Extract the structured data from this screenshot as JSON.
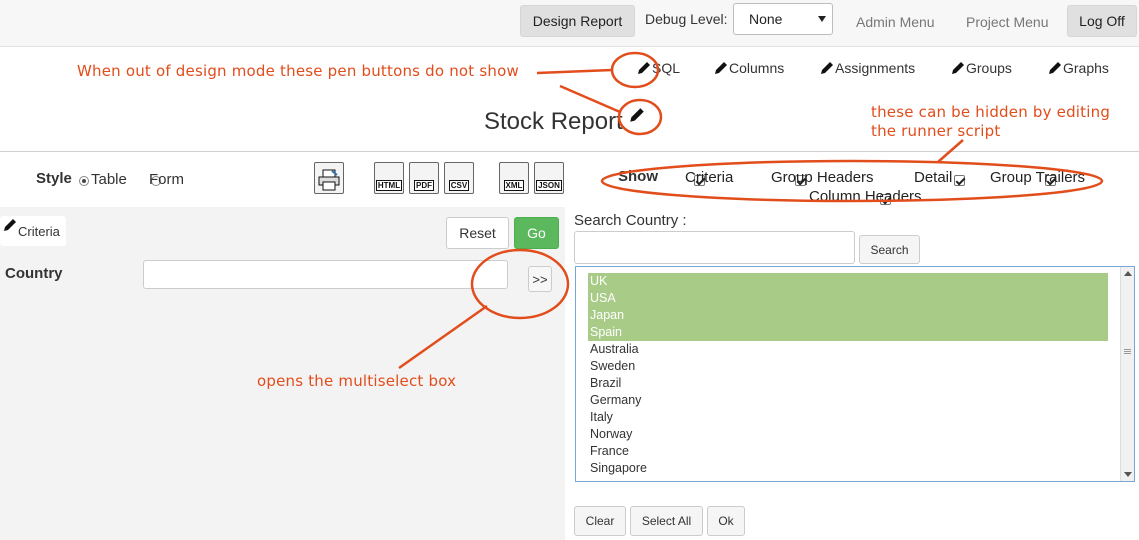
{
  "topbar": {
    "design_report": "Design Report",
    "debug_label": "Debug Level:",
    "debug_value": "None",
    "admin_menu": "Admin Menu",
    "project_menu": "Project Menu",
    "log_off": "Log Off"
  },
  "design_tabs": [
    "SQL",
    "Columns",
    "Assignments",
    "Groups",
    "Graphs"
  ],
  "annotations": {
    "pen_note": "When out of design mode these pen buttons do not show",
    "hidden_note_line1": "these can be hidden by editing",
    "hidden_note_line2": "the runner script",
    "multiselect_note": "opens the multiselect box"
  },
  "report_title": "Stock Report",
  "style": {
    "label": "Style",
    "options": [
      "Table",
      "Form"
    ],
    "selected": "Table"
  },
  "outputs": [
    "HTML",
    "PDF",
    "CSV",
    "XML",
    "JSON"
  ],
  "show": {
    "label": "Show",
    "options": [
      "Criteria",
      "Group Headers",
      "Detail",
      "Group Trailers",
      "Column Headers"
    ]
  },
  "criteria": {
    "link": "Criteria",
    "reset": "Reset",
    "go": "Go",
    "field_label": "Country",
    "expand_button": ">>",
    "field_value": ""
  },
  "search": {
    "label": "Search Country :",
    "button": "Search",
    "value": ""
  },
  "countries": {
    "items": [
      "UK",
      "USA",
      "Japan",
      "Spain",
      "Australia",
      "Sweden",
      "Brazil",
      "Germany",
      "Italy",
      "Norway",
      "France",
      "Singapore"
    ],
    "selected": [
      "UK",
      "USA",
      "Japan",
      "Spain"
    ]
  },
  "list_buttons": {
    "clear": "Clear",
    "select_all": "Select All",
    "ok": "Ok"
  },
  "colors": {
    "annotation": "#e24d1c",
    "go_button": "#5cb85c",
    "selected_option": "#a9cb88",
    "listbox_border": "#79a6d2"
  }
}
